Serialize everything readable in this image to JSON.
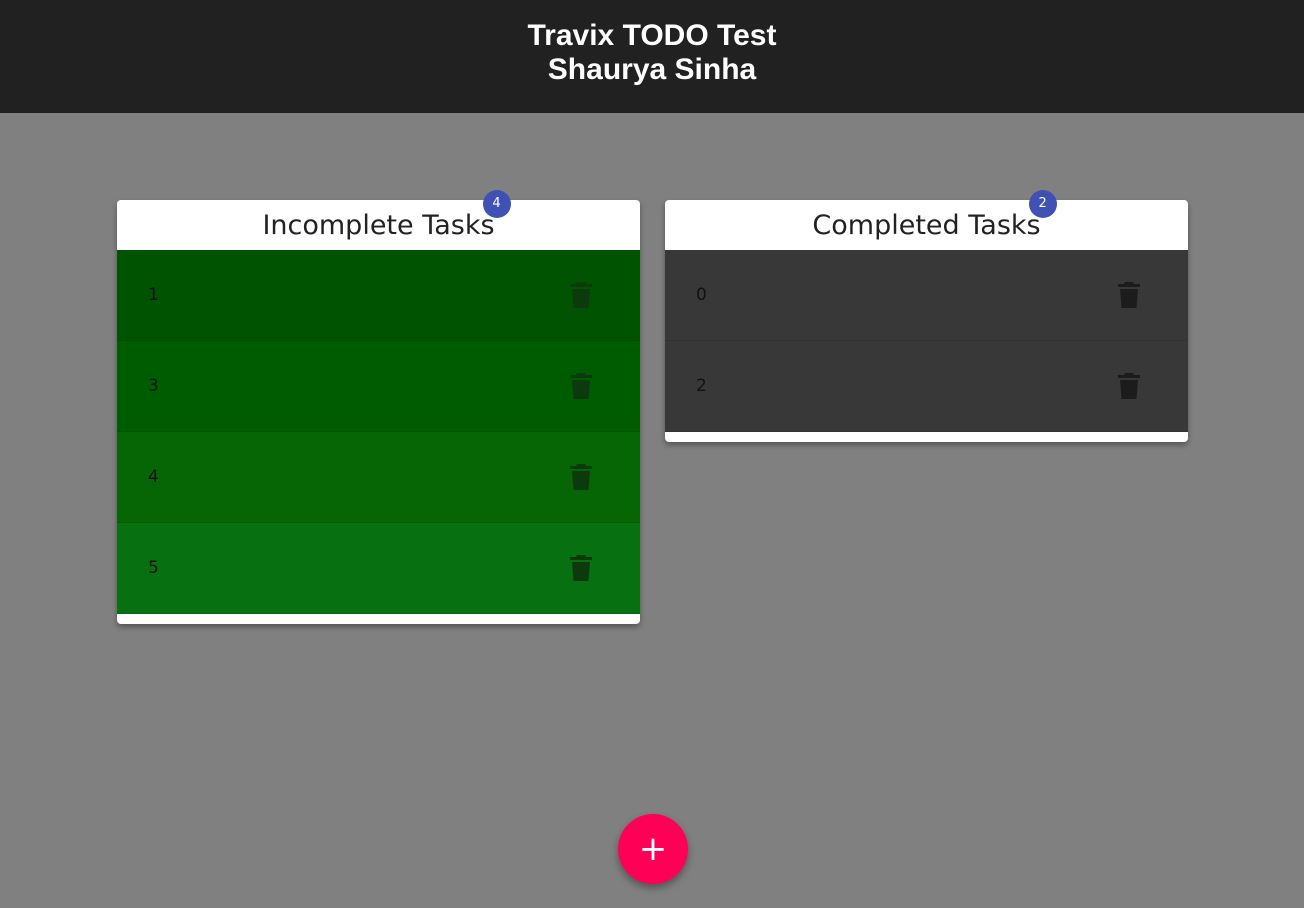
{
  "header": {
    "title": "Travix TODO Test",
    "subtitle": "Shaurya Sinha"
  },
  "incomplete": {
    "title": "Incomplete Tasks",
    "count": "4",
    "items": [
      {
        "label": "1",
        "color": "#005300"
      },
      {
        "label": "3",
        "color": "#005c00"
      },
      {
        "label": "4",
        "color": "#066606"
      },
      {
        "label": "5",
        "color": "#077111"
      }
    ]
  },
  "completed": {
    "title": "Completed Tasks",
    "count": "2",
    "items": [
      {
        "label": "0"
      },
      {
        "label": "2"
      }
    ]
  },
  "fab": {
    "label": "+",
    "color": "#ff0057"
  },
  "colors": {
    "background": "#808080",
    "header": "#212121",
    "badge": "#3f51b5",
    "completed_row": "#383838"
  },
  "icons": {
    "delete": "trash-icon",
    "add": "plus-icon"
  }
}
